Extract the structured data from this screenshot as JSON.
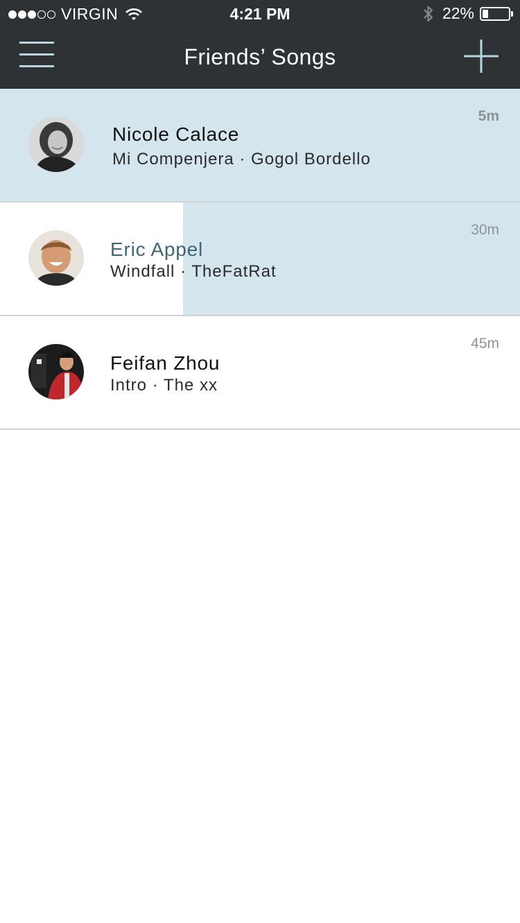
{
  "status_bar": {
    "carrier": "VIRGIN",
    "time": "4:21 PM",
    "battery_percent": "22%",
    "battery_level": 0.22,
    "signal_bars_filled": 3,
    "signal_bars_total": 5
  },
  "header": {
    "title": "Friends’ Songs",
    "menu_icon": "hamburger-menu-icon",
    "add_icon": "plus-icon"
  },
  "colors": {
    "header_bg": "#2f3235",
    "accent": "#b7d6e0",
    "highlight": "#d4e5ed",
    "active_name": "#3f6678"
  },
  "feed": [
    {
      "name": "Nicole Calace",
      "song": "Mi Compenjera · Gogol Bordello",
      "time": "5m",
      "highlight_fraction": 1.0
    },
    {
      "name": "Eric Appel",
      "song": "Windfall · TheFatRat",
      "time": "30m",
      "highlight_fraction": 0.648
    },
    {
      "name": "Feifan Zhou",
      "song": "Intro · The xx",
      "time": "45m",
      "highlight_fraction": 0.0
    }
  ]
}
